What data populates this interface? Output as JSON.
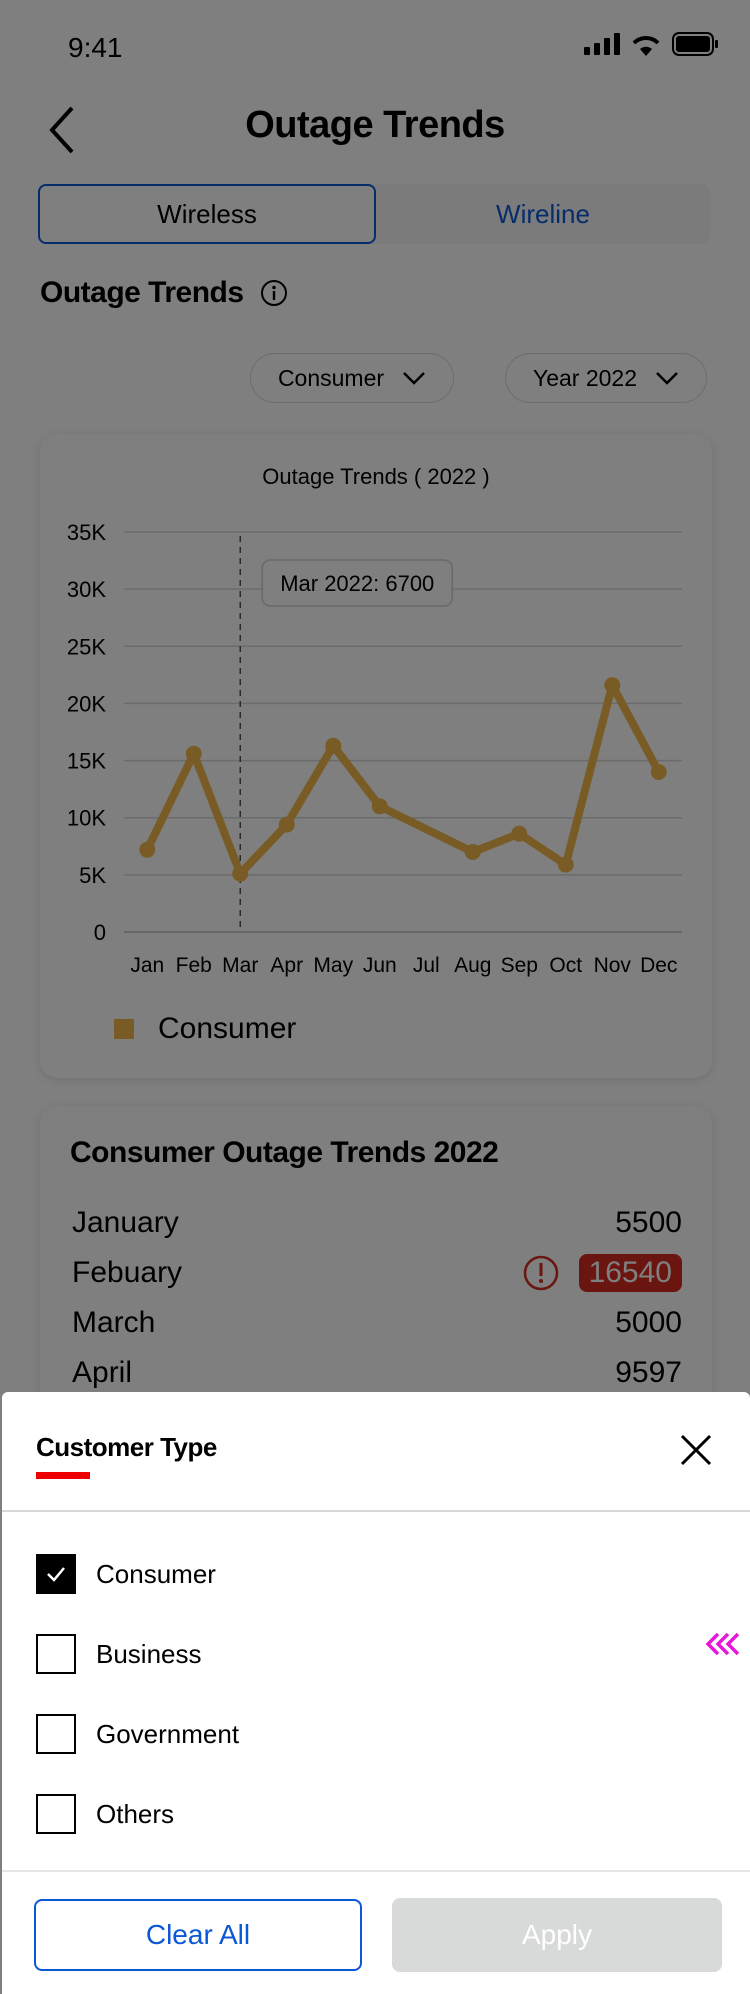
{
  "status_bar": {
    "time": "9:41"
  },
  "header": {
    "title": "Outage Trends"
  },
  "tabs": [
    {
      "label": "Wireless",
      "active": true
    },
    {
      "label": "Wireline",
      "active": false
    }
  ],
  "section": {
    "title": "Outage Trends"
  },
  "filters": {
    "customer_type": "Consumer",
    "year": "Year 2022"
  },
  "chart_data": {
    "type": "line",
    "title": "Outage Trends ( 2022 )",
    "categories": [
      "Jan",
      "Feb",
      "Mar",
      "Apr",
      "May",
      "Jun",
      "Jul",
      "Aug",
      "Sep",
      "Oct",
      "Nov",
      "Dec"
    ],
    "series": [
      {
        "name": "Consumer",
        "values": [
          7200,
          15600,
          5100,
          9400,
          16300,
          11000,
          null,
          7000,
          8600,
          5900,
          21600,
          14000
        ]
      }
    ],
    "y_ticks": [
      "0",
      "5K",
      "10K",
      "15K",
      "20K",
      "25K",
      "30K",
      "35K"
    ],
    "ylim": [
      0,
      35000
    ],
    "grid": true,
    "legend_position": "bottom-left",
    "tooltip": {
      "category": "Mar",
      "text": "Mar 2022: 6700"
    },
    "color": "#f2b84b"
  },
  "table": {
    "title": "Consumer Outage Trends 2022",
    "rows": [
      {
        "month": "January",
        "value": "5500",
        "alert": false
      },
      {
        "month": "Febuary",
        "value": "16540",
        "alert": true
      },
      {
        "month": "March",
        "value": "5000",
        "alert": false
      },
      {
        "month": "April",
        "value": "9597",
        "alert": false
      }
    ]
  },
  "sheet": {
    "title": "Customer Type",
    "options": [
      {
        "label": "Consumer",
        "checked": true
      },
      {
        "label": "Business",
        "checked": false
      },
      {
        "label": "Government",
        "checked": false
      },
      {
        "label": "Others",
        "checked": false
      }
    ],
    "clear_label": "Clear All",
    "apply_label": "Apply"
  },
  "colors": {
    "accent_blue": "#0a58d6",
    "alert_red": "#d52b1e",
    "underline_red": "#ee0000",
    "series": "#f2b84b",
    "side_arrows": "#e617d8"
  }
}
